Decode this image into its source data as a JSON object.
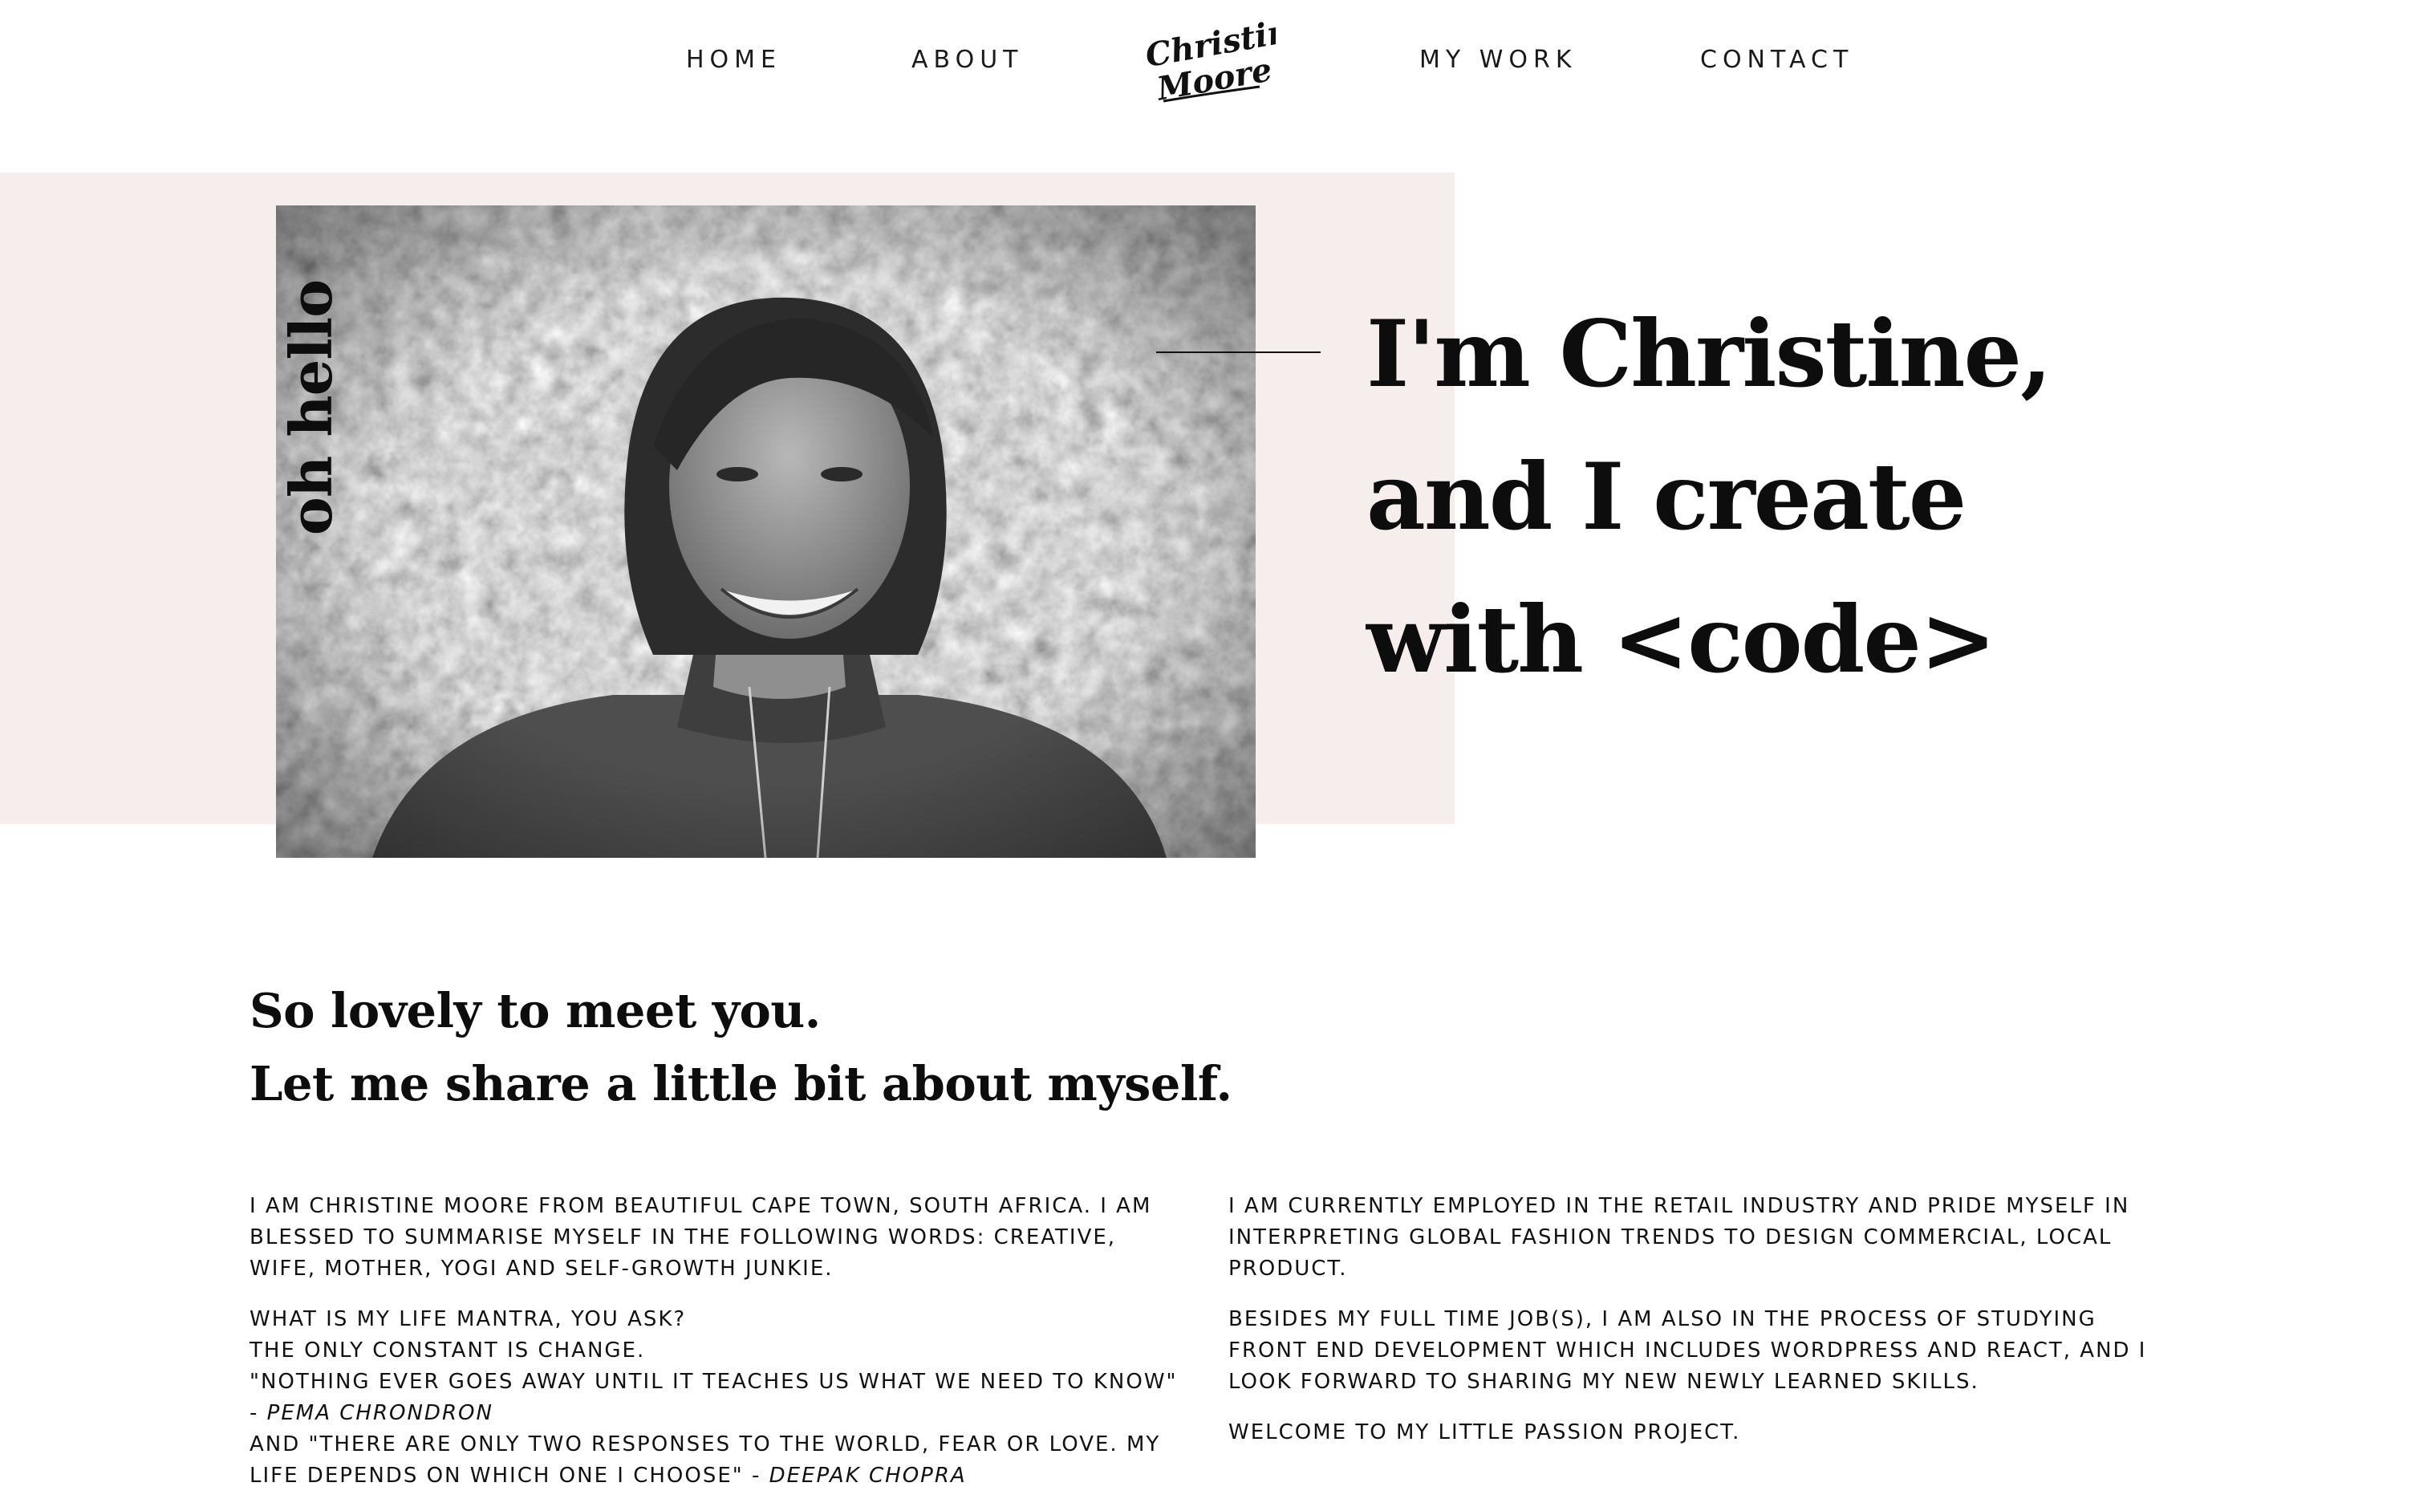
{
  "nav": {
    "home": "HOME",
    "about": "ABOUT",
    "work": "MY WORK",
    "contact": "CONTACT"
  },
  "logo": {
    "line1": "Christine",
    "line2": "Moore"
  },
  "hero": {
    "side_label": "oh hello",
    "title_lines": [
      "I'm Christine,",
      "and I create",
      "with <code>"
    ]
  },
  "intro": {
    "line1": "So lovely to meet you.",
    "line2": "Let me share a little bit about myself."
  },
  "bio_left": {
    "p1": [
      "I am Christine Moore from beautiful Cape Town, South Africa. I am",
      "blessed to summarise myself in the following words: creative,",
      "wife, mother, yogi and self-growth junkie."
    ],
    "p2": [
      "What is my life mantra, you ask?",
      "The only constant is change.",
      "\"Nothing ever goes away until it teaches us what we need to know\""
    ],
    "dash1": "- ",
    "author1": "Pema Chrondron",
    "p3": "and \"There are only two responses to the world, fear or love. My",
    "p4_start": "life depends on which one I choose\" - ",
    "author2": "Deepak Chopra"
  },
  "bio_right": {
    "p1": [
      "I am currently employed in the retail industry and pride myself in",
      "interpreting global fashion trends to design commercial, local",
      "product."
    ],
    "p2": [
      "Besides my full time job(s), I am also in the process of studying",
      "front end development which includes WordPress and React, and I",
      "look forward to sharing my new newly learned skills."
    ],
    "p3": "Welcome to my little passion project."
  },
  "colors": {
    "hero_bg": "#f5eeec",
    "text": "#0d0d0d"
  },
  "icons": {
    "logo": "script-signature-logo"
  }
}
